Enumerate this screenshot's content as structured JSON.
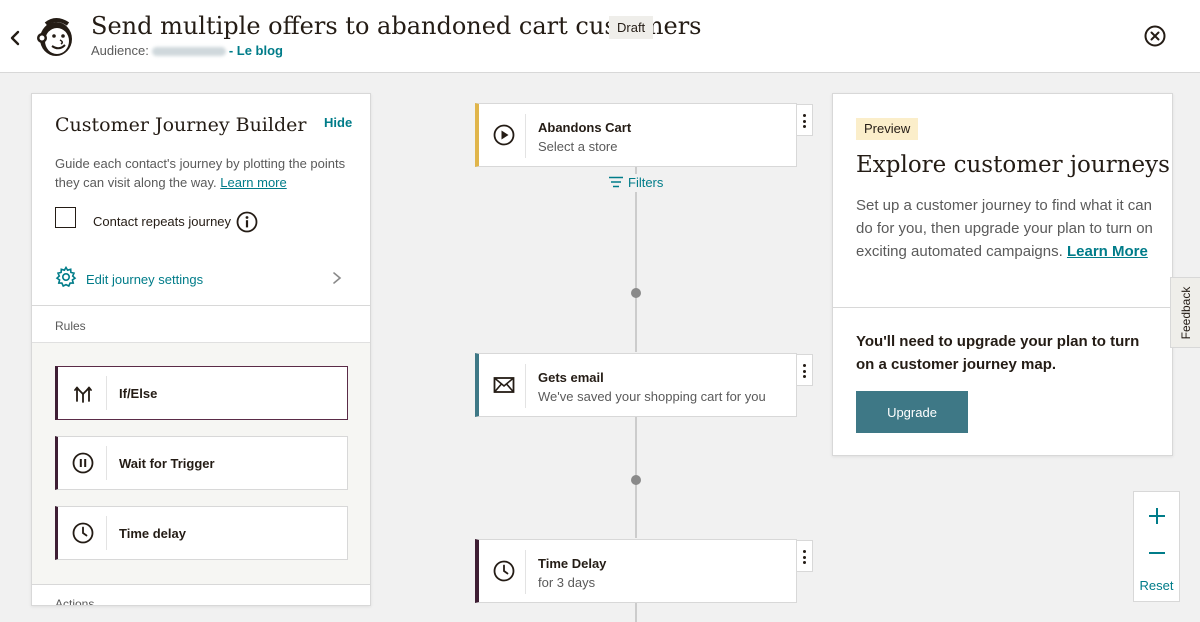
{
  "header": {
    "title": "Send multiple offers to abandoned cart customers",
    "status_badge": "Draft",
    "audience_label": "Audience:",
    "audience_link": "- Le blog",
    "icons": {
      "back": "chevron-left-icon",
      "logo": "mailchimp-freddie-logo",
      "close": "close-circle-icon"
    }
  },
  "builder_panel": {
    "title": "Customer Journey Builder",
    "hide_label": "Hide",
    "description": "Guide each contact's journey by plotting the points they can visit along the way.",
    "learn_more": "Learn more",
    "checkbox_label": "Contact repeats journey",
    "checkbox_checked": false,
    "settings_label": "Edit journey settings",
    "rules_heading": "Rules",
    "rules": [
      {
        "label": "If/Else",
        "icon": "split-arrows-icon",
        "selected": true
      },
      {
        "label": "Wait for Trigger",
        "icon": "pause-circle-icon",
        "selected": false
      },
      {
        "label": "Time delay",
        "icon": "clock-icon",
        "selected": false
      }
    ],
    "actions_heading": "Actions"
  },
  "journey": {
    "nodes": [
      {
        "title": "Abandons Cart",
        "subtitle": "Select a store",
        "icon": "play-circle-icon",
        "accent": "#e0b54b"
      },
      {
        "title": "Gets email",
        "subtitle": "We've saved your shopping cart for you",
        "icon": "envelope-icon",
        "accent": "#3e7886"
      },
      {
        "title": "Time Delay",
        "subtitle": "for 3 days",
        "icon": "clock-icon",
        "accent": "#3e1e34"
      }
    ],
    "filters_label": "Filters"
  },
  "preview_panel": {
    "badge": "Preview",
    "title": "Explore customer journeys",
    "description": "Set up a customer journey to find what it can do for you, then upgrade your plan to turn on exciting automated campaigns.",
    "learn_more": "Learn More",
    "upgrade_notice": "You'll need to upgrade your plan to turn on a customer journey map.",
    "upgrade_button": "Upgrade"
  },
  "feedback_tab": "Feedback",
  "zoom": {
    "reset_label": "Reset"
  },
  "colors": {
    "link": "#007c89",
    "primary_button": "#3e7886",
    "rule_accent": "#3e1e34"
  }
}
